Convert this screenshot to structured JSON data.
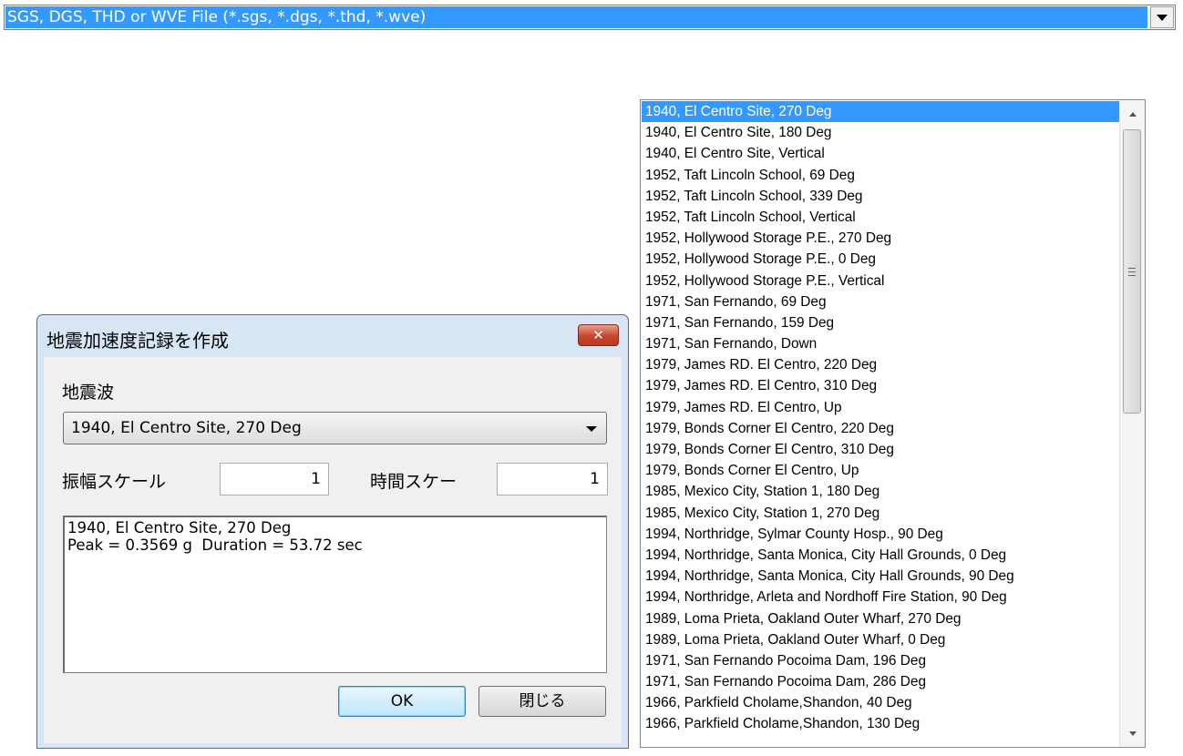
{
  "file_type_select": {
    "value": "SGS, DGS, THD or WVE File (*.sgs, *.dgs, *.thd, *.wve)"
  },
  "quake_list": {
    "selected_index": 0,
    "items": [
      "1940, El Centro Site, 270 Deg",
      "1940, El Centro Site, 180 Deg",
      "1940, El Centro Site, Vertical",
      "1952, Taft Lincoln School, 69 Deg",
      "1952, Taft Lincoln School, 339 Deg",
      "1952, Taft Lincoln School, Vertical",
      "1952, Hollywood Storage P.E., 270 Deg",
      "1952, Hollywood Storage P.E., 0 Deg",
      "1952, Hollywood Storage P.E., Vertical",
      "1971, San Fernando, 69 Deg",
      "1971, San Fernando, 159 Deg",
      "1971, San Fernando, Down",
      "1979, James RD. El Centro, 220 Deg",
      "1979, James RD. El Centro, 310 Deg",
      "1979, James RD. El Centro, Up",
      "1979, Bonds Corner El Centro, 220 Deg",
      "1979, Bonds Corner El Centro, 310 Deg",
      "1979, Bonds Corner El Centro, Up",
      "1985, Mexico City, Station 1, 180 Deg",
      "1985, Mexico City, Station 1, 270 Deg",
      "1994, Northridge, Sylmar County Hosp., 90 Deg",
      "1994, Northridge, Santa Monica, City Hall Grounds, 0 Deg",
      "1994, Northridge, Santa Monica, City Hall Grounds, 90 Deg",
      "1994, Northridge, Arleta and Nordhoff Fire Station, 90 Deg",
      "1989, Loma Prieta, Oakland Outer Wharf, 270 Deg",
      "1989, Loma Prieta, Oakland Outer Wharf, 0 Deg",
      "1971, San Fernando Pocoima Dam, 196 Deg",
      "1971, San Fernando Pocoima Dam, 286 Deg",
      "1966, Parkfield Cholame,Shandon, 40 Deg",
      "1966, Parkfield Cholame,Shandon, 130 Deg"
    ]
  },
  "dialog": {
    "title": "地震加速度記録を作成",
    "close_glyph": "✕",
    "wave_label": "地震波",
    "wave_value": "1940, El Centro Site, 270 Deg",
    "amp_label": "振幅スケール",
    "amp_value": "1",
    "time_label": "時間スケー",
    "time_value": "1",
    "info_text": "1940, El Centro Site, 270 Deg\nPeak = 0.3569 g  Duration = 53.72 sec",
    "ok_label": "OK",
    "close_label": "閉じる"
  },
  "colors": {
    "selection": "#3399ff",
    "dialog_frame": "#d7e5f5",
    "close_button": "#c7462a"
  }
}
